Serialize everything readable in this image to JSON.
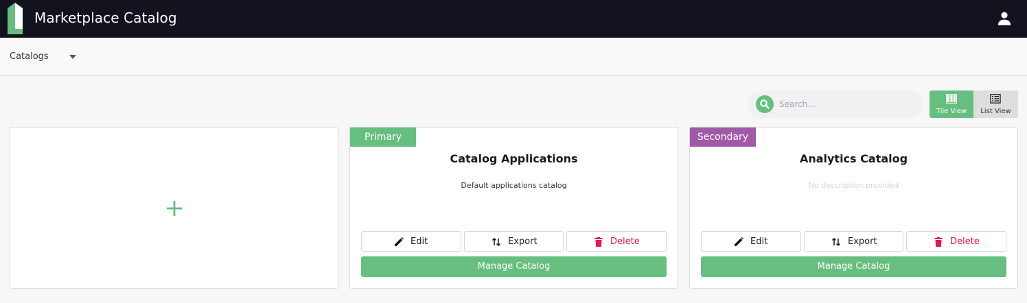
{
  "header": {
    "title": "Marketplace Catalog",
    "logo_icon": "marketplace-logo",
    "user_icon": "user-icon"
  },
  "catalogs_select": {
    "label": "Catalogs",
    "icon": "caret-down-icon"
  },
  "search": {
    "placeholder": "Search...",
    "value": "",
    "icon": "search-icon"
  },
  "view_toggle": {
    "tile_label": "Tile View",
    "list_label": "List View",
    "active": "tile"
  },
  "add_card": {
    "icon": "plus-icon"
  },
  "catalogs": [
    {
      "badge": "Primary",
      "badge_color": "#66bf7f",
      "title": "Catalog Applications",
      "description": "Default applications catalog",
      "edit_label": "Edit",
      "export_label": "Export",
      "delete_label": "Delete",
      "manage_label": "Manage Catalog"
    },
    {
      "badge": "Secondary",
      "badge_color": "#a05aa7",
      "title": "Analytics Catalog",
      "description": "No description provided",
      "edit_label": "Edit",
      "export_label": "Export",
      "delete_label": "Delete",
      "manage_label": "Manage Catalog"
    }
  ],
  "colors": {
    "header_bg": "#13131f",
    "accent_green": "#66bf7f",
    "secondary_purple": "#a05aa7",
    "delete_red": "#e0194f"
  }
}
